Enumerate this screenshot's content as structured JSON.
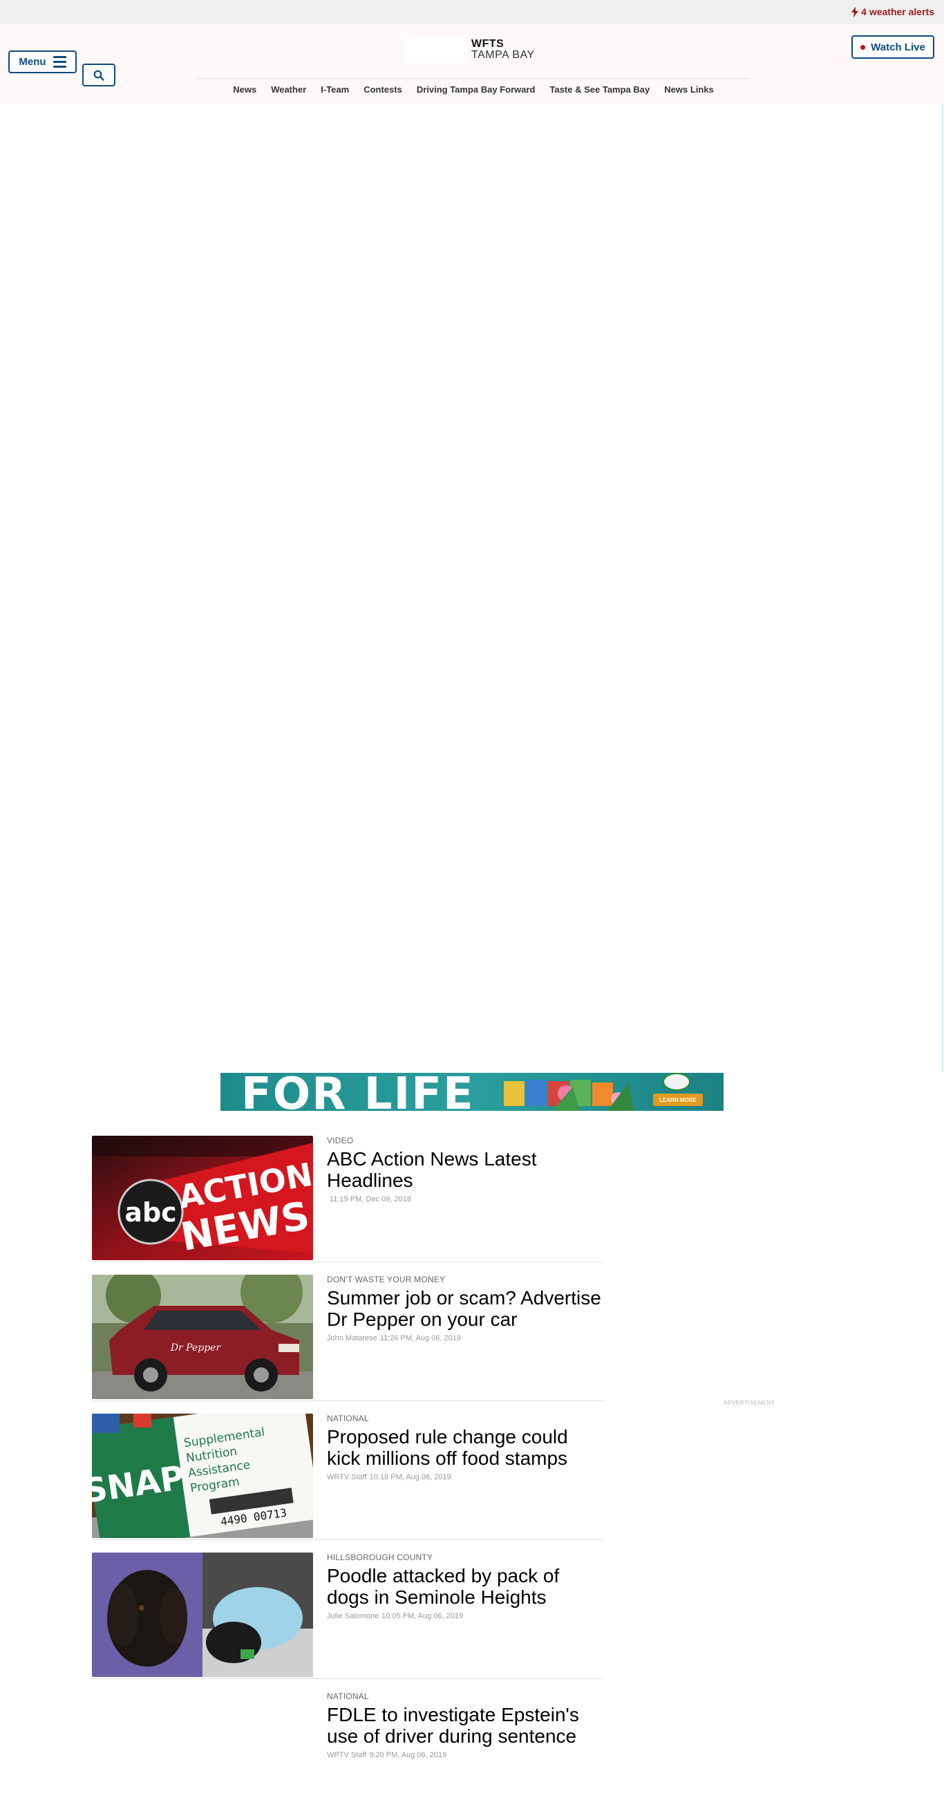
{
  "alerts": {
    "label": "4 weather alerts",
    "color": "#9b1b1b"
  },
  "header": {
    "menu_label": "Menu",
    "logo_call": "WFTS",
    "logo_market": "TAMPA BAY",
    "watch_live_label": "Watch Live",
    "brand_color": "#0f4a7d",
    "live_dot_color": "#c0151b"
  },
  "nav": {
    "items": [
      {
        "label": "News"
      },
      {
        "label": "Weather"
      },
      {
        "label": "I-Team"
      },
      {
        "label": "Contests"
      },
      {
        "label": "Driving Tampa Bay Forward"
      },
      {
        "label": "Taste & See Tampa Bay"
      },
      {
        "label": "News Links"
      }
    ]
  },
  "banner": {
    "headline": "FOR LIFE",
    "cta": "LEARN MORE"
  },
  "ad_label": "ADVERTISEMENT",
  "thumb_texts": {
    "abc": "abc",
    "action": "ACTION",
    "news": "NEWS",
    "snap_letters": "SNAP",
    "snap_lines": [
      "Supplemental",
      "Nutrition",
      "Assistance",
      "Program"
    ],
    "snap_number": "4490 00713",
    "truck_logo": "Dr Pepper"
  },
  "stories": [
    {
      "kicker": "VIDEO",
      "headline": "ABC Action News Latest Headlines",
      "author": "",
      "time": "11:19 PM, Dec 09, 2018",
      "thumb": "abc-action-news-logo"
    },
    {
      "kicker": "DON'T WASTE YOUR MONEY",
      "headline": "Summer job or scam? Advertise Dr Pepper on your car",
      "author": "John Matarese",
      "time": "11:26 PM, Aug 06, 2019",
      "thumb": "red-suv-photo"
    },
    {
      "kicker": "NATIONAL",
      "headline": "Proposed rule change could kick millions off food stamps",
      "author": "WRTV Staff",
      "time": "10:18 PM, Aug 06, 2019",
      "thumb": "snap-card-photo"
    },
    {
      "kicker": "HILLSBOROUGH COUNTY",
      "headline": "Poodle attacked by pack of dogs in Seminole Heights",
      "author": "Julie Salomone",
      "time": "10:05 PM, Aug 06, 2019",
      "thumb": "poodle-photo"
    },
    {
      "kicker": "NATIONAL",
      "headline": "FDLE to investigate Epstein's use of driver during sentence",
      "author": "WPTV Staff",
      "time": "9:20 PM, Aug 06, 2019",
      "thumb": ""
    }
  ]
}
